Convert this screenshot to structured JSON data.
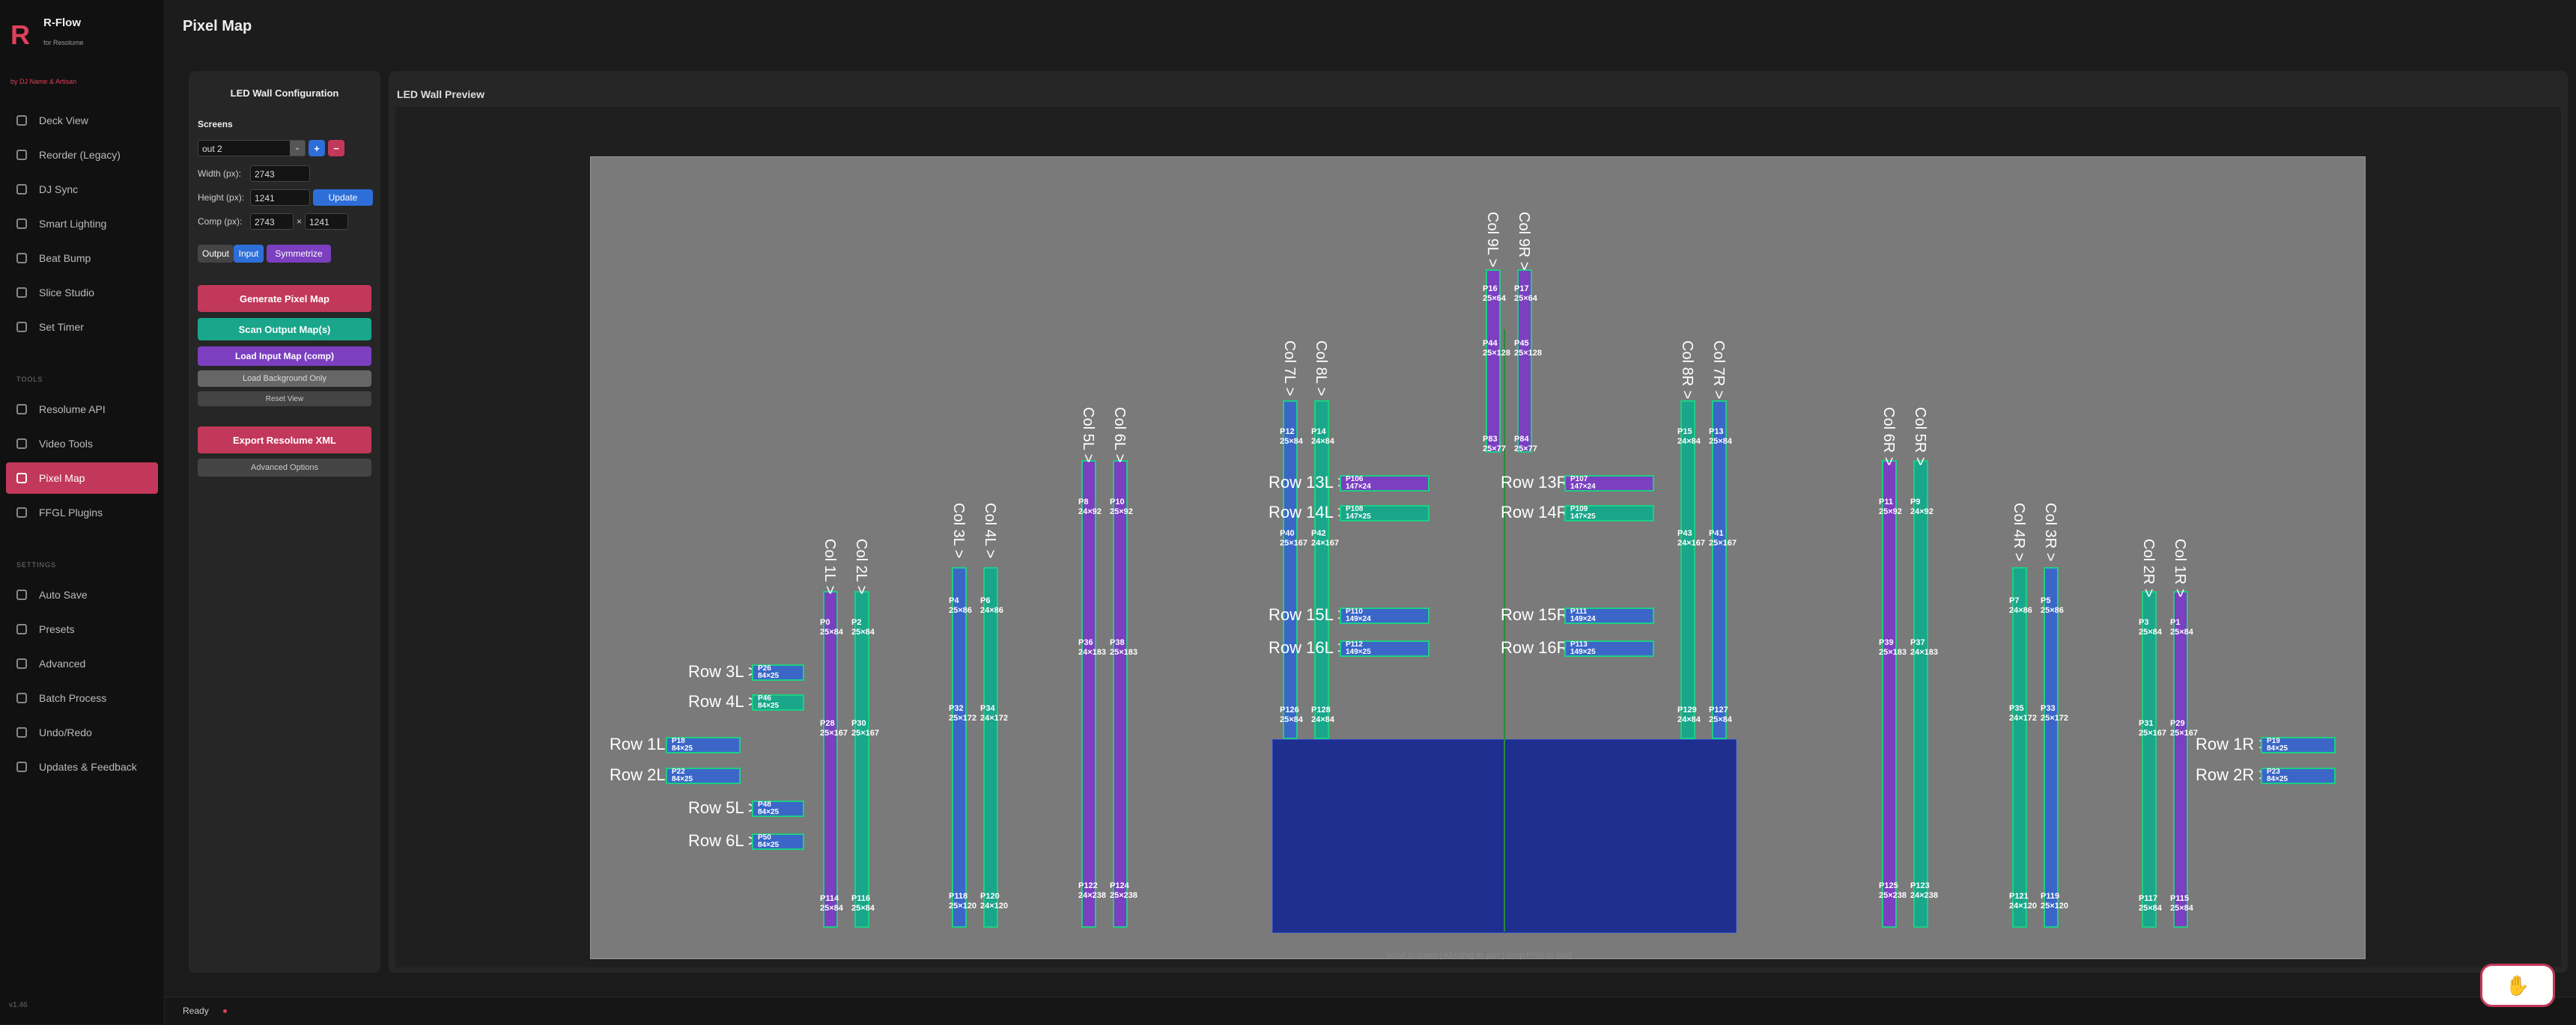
{
  "app": {
    "name": "R-Flow",
    "subtitle": "for Resolume",
    "by": "by DJ Name & Artisan",
    "version": "v1.46"
  },
  "nav": {
    "items": [
      {
        "label": "Deck View",
        "icon": "deck-icon"
      },
      {
        "label": "Reorder (Legacy)",
        "icon": "reorder-icon"
      },
      {
        "label": "DJ Sync",
        "icon": "sync-icon"
      },
      {
        "label": "Smart Lighting",
        "icon": "lightbulb-icon"
      },
      {
        "label": "Beat Bump",
        "icon": "beat-icon"
      },
      {
        "label": "Slice Studio",
        "icon": "slice-icon"
      },
      {
        "label": "Set Timer",
        "icon": "timer-icon"
      }
    ],
    "tools_header": "TOOLS",
    "tools": [
      {
        "label": "Resolume API",
        "icon": "api-icon"
      },
      {
        "label": "Video Tools",
        "icon": "video-icon"
      },
      {
        "label": "Pixel Map",
        "icon": "pixelmap-icon",
        "active": true
      },
      {
        "label": "FFGL Plugins",
        "icon": "plugin-icon"
      }
    ],
    "settings_header": "SETTINGS",
    "settings": [
      {
        "label": "Auto Save",
        "icon": "save-icon"
      },
      {
        "label": "Presets",
        "icon": "presets-icon"
      },
      {
        "label": "Advanced",
        "icon": "advanced-icon"
      },
      {
        "label": "Batch Process",
        "icon": "batch-icon"
      },
      {
        "label": "Undo/Redo",
        "icon": "undo-icon"
      },
      {
        "label": "Updates & Feedback",
        "icon": "feedback-icon"
      }
    ]
  },
  "page_title": "Pixel Map",
  "config": {
    "title": "LED Wall Configuration",
    "screens_label": "Screens",
    "screen_select": "out 2",
    "add_label": "+",
    "remove_label": "−",
    "width_label": "Width (px):",
    "width_value": "2743",
    "height_label": "Height (px):",
    "height_value": "1241",
    "update_label": "Update",
    "comp_label": "Comp (px):",
    "comp_w": "2743",
    "comp_x": "×",
    "comp_h": "1241",
    "output_label": "Output",
    "input_label": "Input",
    "symmetrize_label": "Symmetrize",
    "generate_label": "Generate Pixel Map",
    "scan_label": "Scan Output Map(s)",
    "load_input_label": "Load Input Map (comp)",
    "load_bg_label": "Load Background Only",
    "reset_label": "Reset View",
    "export_label": "Export Resolume XML",
    "advanced_label": "Advanced Options"
  },
  "preview": {
    "title": "LED Wall Preview",
    "hint": "Scroll to zoom | Alt+drag to pan | Drop PNG to load"
  },
  "colors": {
    "accent": "#c2385a",
    "teal": "#1aa68a",
    "purple": "#7b3fc0",
    "blue": "#3b66c8",
    "strip_border": "#1ccf84"
  },
  "status": {
    "text": "Ready"
  },
  "map": {
    "cols": [
      {
        "name": "Col 1L >",
        "p_top": "P0",
        "dim_top": "25×84",
        "p_mid": "P28",
        "dim_mid": "25×167",
        "p_bot": "P114",
        "dim_bot": "25×84"
      },
      {
        "name": "Col 2L >",
        "p_top": "P2",
        "dim_top": "25×84",
        "p_mid": "P30",
        "dim_mid": "25×167",
        "p_bot": "P116",
        "dim_bot": "25×84"
      },
      {
        "name": "Col 3L >",
        "p_top": "P4",
        "dim_top": "25×86",
        "p_mid": "P32",
        "dim_mid": "25×172",
        "p_bot": "P118",
        "dim_bot": "25×120"
      },
      {
        "name": "Col 4L >",
        "p_top": "P6",
        "dim_top": "24×86",
        "p_mid": "P34",
        "dim_mid": "24×172",
        "p_bot": "P120",
        "dim_bot": "24×120"
      },
      {
        "name": "Col 5L >",
        "p_top": "P8",
        "dim_top": "24×92",
        "p_mid": "P36",
        "dim_mid": "24×183",
        "p_bot": "P122",
        "dim_bot": "24×238"
      },
      {
        "name": "Col 6L >",
        "p_top": "P10",
        "dim_top": "25×92",
        "p_mid": "P38",
        "dim_mid": "25×183",
        "p_bot": "P124",
        "dim_bot": "25×238"
      },
      {
        "name": "Col 7L >",
        "p_top": "P12",
        "dim_top": "25×84",
        "p_mid": "P40",
        "dim_mid": "25×167",
        "p_bot": "P126",
        "dim_bot": "25×84"
      },
      {
        "name": "Col 8L >",
        "p_top": "P14",
        "dim_top": "24×84",
        "p_mid": "P42",
        "dim_mid": "24×167",
        "p_bot": "P128",
        "dim_bot": "24×84"
      },
      {
        "name": "Col 9L >",
        "p_top": "P16",
        "dim_top": "25×64",
        "p_mid": "P44",
        "dim_mid": "25×128",
        "p_bot": "P83",
        "dim_bot": "25×77"
      },
      {
        "name": "Col 9R >",
        "p_top": "P17",
        "dim_top": "25×64",
        "p_mid": "P45",
        "dim_mid": "25×128",
        "p_bot": "P84",
        "dim_bot": "25×77"
      },
      {
        "name": "Col 8R >",
        "p_top": "P15",
        "dim_top": "24×84",
        "p_mid": "P43",
        "dim_mid": "24×167",
        "p_bot": "P129",
        "dim_bot": "24×84"
      },
      {
        "name": "Col 7R >",
        "p_top": "P13",
        "dim_top": "25×84",
        "p_mid": "P41",
        "dim_mid": "25×167",
        "p_bot": "P127",
        "dim_bot": "25×84"
      },
      {
        "name": "Col 6R >",
        "p_top": "P11",
        "dim_top": "25×92",
        "p_mid": "P39",
        "dim_mid": "25×183",
        "p_bot": "P125",
        "dim_bot": "25×238"
      },
      {
        "name": "Col 5R >",
        "p_top": "P9",
        "dim_top": "24×92",
        "p_mid": "P37",
        "dim_mid": "24×183",
        "p_bot": "P123",
        "dim_bot": "24×238"
      },
      {
        "name": "Col 4R >",
        "p_top": "P7",
        "dim_top": "24×86",
        "p_mid": "P35",
        "dim_mid": "24×172",
        "p_bot": "P121",
        "dim_bot": "24×120"
      },
      {
        "name": "Col 3R >",
        "p_top": "P5",
        "dim_top": "25×86",
        "p_mid": "P33",
        "dim_mid": "25×172",
        "p_bot": "P119",
        "dim_bot": "25×120"
      },
      {
        "name": "Col 2R >",
        "p_top": "P3",
        "dim_top": "25×84",
        "p_mid": "P31",
        "dim_mid": "25×167",
        "p_bot": "P117",
        "dim_bot": "25×84"
      },
      {
        "name": "Col 1R >",
        "p_top": "P1",
        "dim_top": "25×84",
        "p_mid": "P29",
        "dim_mid": "25×167",
        "p_bot": "P115",
        "dim_bot": "25×84"
      }
    ],
    "rows": [
      {
        "name": "Row 3L >",
        "p": "P26",
        "dim": "84×25"
      },
      {
        "name": "Row 4L >",
        "p": "P46",
        "dim": "84×25"
      },
      {
        "name": "Row 1L >",
        "p": "P18",
        "dim": "84×25"
      },
      {
        "name": "Row 2L >",
        "p": "P22",
        "dim": "84×25"
      },
      {
        "name": "Row 5L >",
        "p": "P48",
        "dim": "84×25"
      },
      {
        "name": "Row 6L >",
        "p": "P50",
        "dim": "84×25"
      },
      {
        "name": "Row 13L >",
        "p": "P106",
        "dim": "147×24"
      },
      {
        "name": "Row 14L >",
        "p": "P108",
        "dim": "147×25"
      },
      {
        "name": "Row 15L >",
        "p": "P110",
        "dim": "149×24"
      },
      {
        "name": "Row 16L >",
        "p": "P112",
        "dim": "149×25"
      },
      {
        "name": "Row 13R >",
        "p": "P107",
        "dim": "147×24"
      },
      {
        "name": "Row 14R >",
        "p": "P109",
        "dim": "147×25"
      },
      {
        "name": "Row 15R >",
        "p": "P111",
        "dim": "149×24"
      },
      {
        "name": "Row 16R >",
        "p": "P113",
        "dim": "149×25"
      },
      {
        "name": "Row 1R >",
        "p": "P19",
        "dim": "84×25"
      },
      {
        "name": "Row 2R >",
        "p": "P23",
        "dim": "84×25"
      }
    ]
  }
}
